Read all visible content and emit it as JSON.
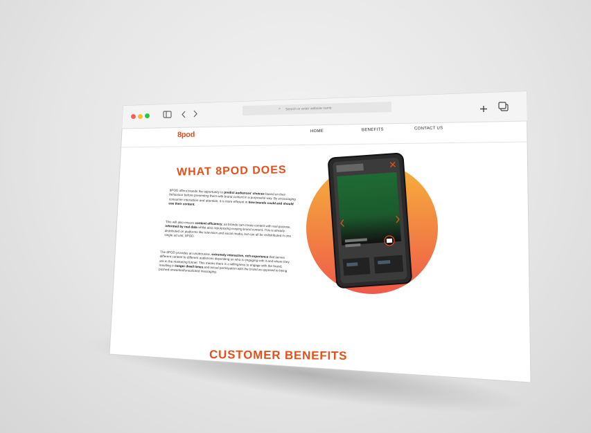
{
  "browser": {
    "search_placeholder": "Search or enter website name",
    "traffic_colors": [
      "#ff5f57",
      "#febc2e",
      "#28c840"
    ]
  },
  "site": {
    "logo": "8pod",
    "nav": [
      "HOME",
      "BENEFITS",
      "CONTACT US"
    ],
    "accent_color": "#e4501a"
  },
  "section_what": {
    "title": "WHAT 8POD DOES",
    "paragraph1": [
      {
        "t": "8POD offers brands the opportunity to ",
        "b": false
      },
      {
        "t": "predict audiences' choices",
        "b": true
      },
      {
        "t": " based on their behaviour before presenting them with brand content in a purposeful way. By encouraging consumer interaction and attention, it is more efficient in ",
        "b": false
      },
      {
        "t": "how brands could and should use their content.",
        "b": true
      }
    ],
    "paragraph2": [
      {
        "t": "This will also ensure ",
        "b": false
      },
      {
        "t": "content efficiency",
        "b": true
      },
      {
        "t": ", as brands can create content with real purpose, ",
        "b": false
      },
      {
        "t": "informed by real data",
        "b": true
      },
      {
        "t": " whilst also repurposing existing brand content. This is already distributed on platforms like television and social media, but can all be redistributed in one single ad unit, 8POD.",
        "b": false
      }
    ],
    "paragraph3": [
      {
        "t": "The 8POD provides an unobtrusive, ",
        "b": false
      },
      {
        "t": "extremely interactive, rich experience",
        "b": true
      },
      {
        "t": " that serves different content to different audiences depending on who is engaging with it and where they are in the marketing funnel. This means there is a willingness to engage with the brand, resulting in ",
        "b": false
      },
      {
        "t": "longer dwell times",
        "b": true
      },
      {
        "t": " and actual participation with the brand as opposed to being pushed unwanted/unsolicited messaging.",
        "b": false
      }
    ]
  },
  "section_benefits": {
    "title": "CUSTOMER BENEFITS"
  },
  "phone": {
    "screen_color": "#1f6b34",
    "circle_top_color": "#f5b23a",
    "circle_bottom_color": "#ef5a4a"
  }
}
